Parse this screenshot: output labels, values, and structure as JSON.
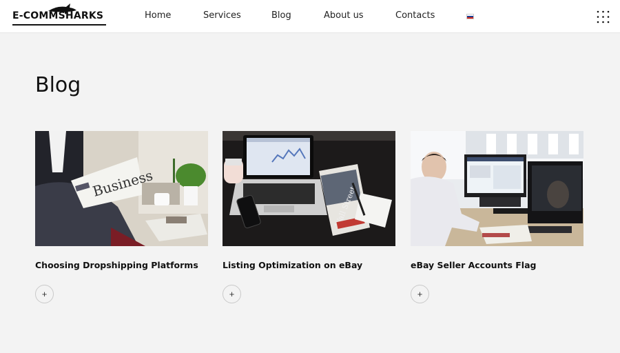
{
  "header": {
    "logo_text": "E-COMMSHARKS",
    "nav": [
      {
        "label": "Home"
      },
      {
        "label": "Services"
      },
      {
        "label": "Blog"
      },
      {
        "label": "About us"
      },
      {
        "label": "Contacts"
      }
    ],
    "language_flag": "russia-flag-icon",
    "menu_icon": "grid-dots-icon"
  },
  "main": {
    "title": "Blog",
    "posts": [
      {
        "title": "Choosing Dropshipping Platforms",
        "image": "businessman-reading-newspaper",
        "button": "+"
      },
      {
        "title": "Listing Optimization on eBay",
        "image": "laptop-phone-desk",
        "button": "+"
      },
      {
        "title": "eBay Seller Accounts Flag",
        "image": "man-at-computer-office",
        "button": "+"
      }
    ]
  },
  "colors": {
    "page_bg": "#f3f3f3",
    "header_bg": "#ffffff",
    "text": "#111111",
    "flag_white": "#ffffff",
    "flag_blue": "#1c3f94",
    "flag_red": "#d52b1e"
  }
}
